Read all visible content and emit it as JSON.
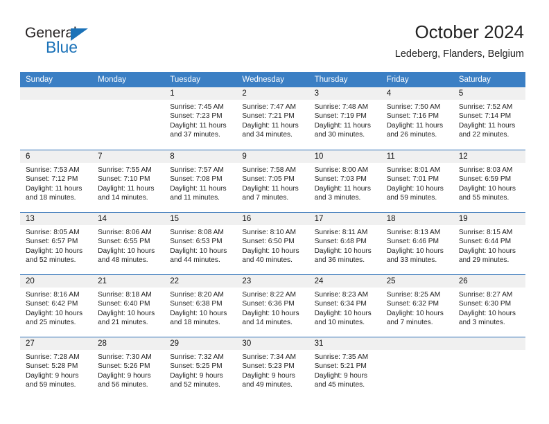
{
  "logo": {
    "word_one": "General",
    "word_two": "Blue",
    "triangle_color": "#1b72b8"
  },
  "header": {
    "title": "October 2024",
    "subtitle": "Ledeberg, Flanders, Belgium"
  },
  "theme": {
    "header_bg": "#3b7fc4",
    "row_divider": "#2a6db5",
    "date_strip_bg": "#f0f0f0",
    "text": "#222222"
  },
  "calendar": {
    "weekday_headers": [
      "Sunday",
      "Monday",
      "Tuesday",
      "Wednesday",
      "Thursday",
      "Friday",
      "Saturday"
    ],
    "labels": {
      "sunrise": "Sunrise:",
      "sunset": "Sunset:",
      "daylight": "Daylight:"
    },
    "weeks": [
      [
        {
          "date": "",
          "blank": true
        },
        {
          "date": "",
          "blank": true
        },
        {
          "date": "1",
          "sunrise": "Sunrise: 7:45 AM",
          "sunset": "Sunset: 7:23 PM",
          "daylight": "Daylight: 11 hours and 37 minutes."
        },
        {
          "date": "2",
          "sunrise": "Sunrise: 7:47 AM",
          "sunset": "Sunset: 7:21 PM",
          "daylight": "Daylight: 11 hours and 34 minutes."
        },
        {
          "date": "3",
          "sunrise": "Sunrise: 7:48 AM",
          "sunset": "Sunset: 7:19 PM",
          "daylight": "Daylight: 11 hours and 30 minutes."
        },
        {
          "date": "4",
          "sunrise": "Sunrise: 7:50 AM",
          "sunset": "Sunset: 7:16 PM",
          "daylight": "Daylight: 11 hours and 26 minutes."
        },
        {
          "date": "5",
          "sunrise": "Sunrise: 7:52 AM",
          "sunset": "Sunset: 7:14 PM",
          "daylight": "Daylight: 11 hours and 22 minutes."
        }
      ],
      [
        {
          "date": "6",
          "sunrise": "Sunrise: 7:53 AM",
          "sunset": "Sunset: 7:12 PM",
          "daylight": "Daylight: 11 hours and 18 minutes."
        },
        {
          "date": "7",
          "sunrise": "Sunrise: 7:55 AM",
          "sunset": "Sunset: 7:10 PM",
          "daylight": "Daylight: 11 hours and 14 minutes."
        },
        {
          "date": "8",
          "sunrise": "Sunrise: 7:57 AM",
          "sunset": "Sunset: 7:08 PM",
          "daylight": "Daylight: 11 hours and 11 minutes."
        },
        {
          "date": "9",
          "sunrise": "Sunrise: 7:58 AM",
          "sunset": "Sunset: 7:05 PM",
          "daylight": "Daylight: 11 hours and 7 minutes."
        },
        {
          "date": "10",
          "sunrise": "Sunrise: 8:00 AM",
          "sunset": "Sunset: 7:03 PM",
          "daylight": "Daylight: 11 hours and 3 minutes."
        },
        {
          "date": "11",
          "sunrise": "Sunrise: 8:01 AM",
          "sunset": "Sunset: 7:01 PM",
          "daylight": "Daylight: 10 hours and 59 minutes."
        },
        {
          "date": "12",
          "sunrise": "Sunrise: 8:03 AM",
          "sunset": "Sunset: 6:59 PM",
          "daylight": "Daylight: 10 hours and 55 minutes."
        }
      ],
      [
        {
          "date": "13",
          "sunrise": "Sunrise: 8:05 AM",
          "sunset": "Sunset: 6:57 PM",
          "daylight": "Daylight: 10 hours and 52 minutes."
        },
        {
          "date": "14",
          "sunrise": "Sunrise: 8:06 AM",
          "sunset": "Sunset: 6:55 PM",
          "daylight": "Daylight: 10 hours and 48 minutes."
        },
        {
          "date": "15",
          "sunrise": "Sunrise: 8:08 AM",
          "sunset": "Sunset: 6:53 PM",
          "daylight": "Daylight: 10 hours and 44 minutes."
        },
        {
          "date": "16",
          "sunrise": "Sunrise: 8:10 AM",
          "sunset": "Sunset: 6:50 PM",
          "daylight": "Daylight: 10 hours and 40 minutes."
        },
        {
          "date": "17",
          "sunrise": "Sunrise: 8:11 AM",
          "sunset": "Sunset: 6:48 PM",
          "daylight": "Daylight: 10 hours and 36 minutes."
        },
        {
          "date": "18",
          "sunrise": "Sunrise: 8:13 AM",
          "sunset": "Sunset: 6:46 PM",
          "daylight": "Daylight: 10 hours and 33 minutes."
        },
        {
          "date": "19",
          "sunrise": "Sunrise: 8:15 AM",
          "sunset": "Sunset: 6:44 PM",
          "daylight": "Daylight: 10 hours and 29 minutes."
        }
      ],
      [
        {
          "date": "20",
          "sunrise": "Sunrise: 8:16 AM",
          "sunset": "Sunset: 6:42 PM",
          "daylight": "Daylight: 10 hours and 25 minutes."
        },
        {
          "date": "21",
          "sunrise": "Sunrise: 8:18 AM",
          "sunset": "Sunset: 6:40 PM",
          "daylight": "Daylight: 10 hours and 21 minutes."
        },
        {
          "date": "22",
          "sunrise": "Sunrise: 8:20 AM",
          "sunset": "Sunset: 6:38 PM",
          "daylight": "Daylight: 10 hours and 18 minutes."
        },
        {
          "date": "23",
          "sunrise": "Sunrise: 8:22 AM",
          "sunset": "Sunset: 6:36 PM",
          "daylight": "Daylight: 10 hours and 14 minutes."
        },
        {
          "date": "24",
          "sunrise": "Sunrise: 8:23 AM",
          "sunset": "Sunset: 6:34 PM",
          "daylight": "Daylight: 10 hours and 10 minutes."
        },
        {
          "date": "25",
          "sunrise": "Sunrise: 8:25 AM",
          "sunset": "Sunset: 6:32 PM",
          "daylight": "Daylight: 10 hours and 7 minutes."
        },
        {
          "date": "26",
          "sunrise": "Sunrise: 8:27 AM",
          "sunset": "Sunset: 6:30 PM",
          "daylight": "Daylight: 10 hours and 3 minutes."
        }
      ],
      [
        {
          "date": "27",
          "sunrise": "Sunrise: 7:28 AM",
          "sunset": "Sunset: 5:28 PM",
          "daylight": "Daylight: 9 hours and 59 minutes."
        },
        {
          "date": "28",
          "sunrise": "Sunrise: 7:30 AM",
          "sunset": "Sunset: 5:26 PM",
          "daylight": "Daylight: 9 hours and 56 minutes."
        },
        {
          "date": "29",
          "sunrise": "Sunrise: 7:32 AM",
          "sunset": "Sunset: 5:25 PM",
          "daylight": "Daylight: 9 hours and 52 minutes."
        },
        {
          "date": "30",
          "sunrise": "Sunrise: 7:34 AM",
          "sunset": "Sunset: 5:23 PM",
          "daylight": "Daylight: 9 hours and 49 minutes."
        },
        {
          "date": "31",
          "sunrise": "Sunrise: 7:35 AM",
          "sunset": "Sunset: 5:21 PM",
          "daylight": "Daylight: 9 hours and 45 minutes."
        },
        {
          "date": "",
          "blank": true
        },
        {
          "date": "",
          "blank": true
        }
      ]
    ]
  }
}
